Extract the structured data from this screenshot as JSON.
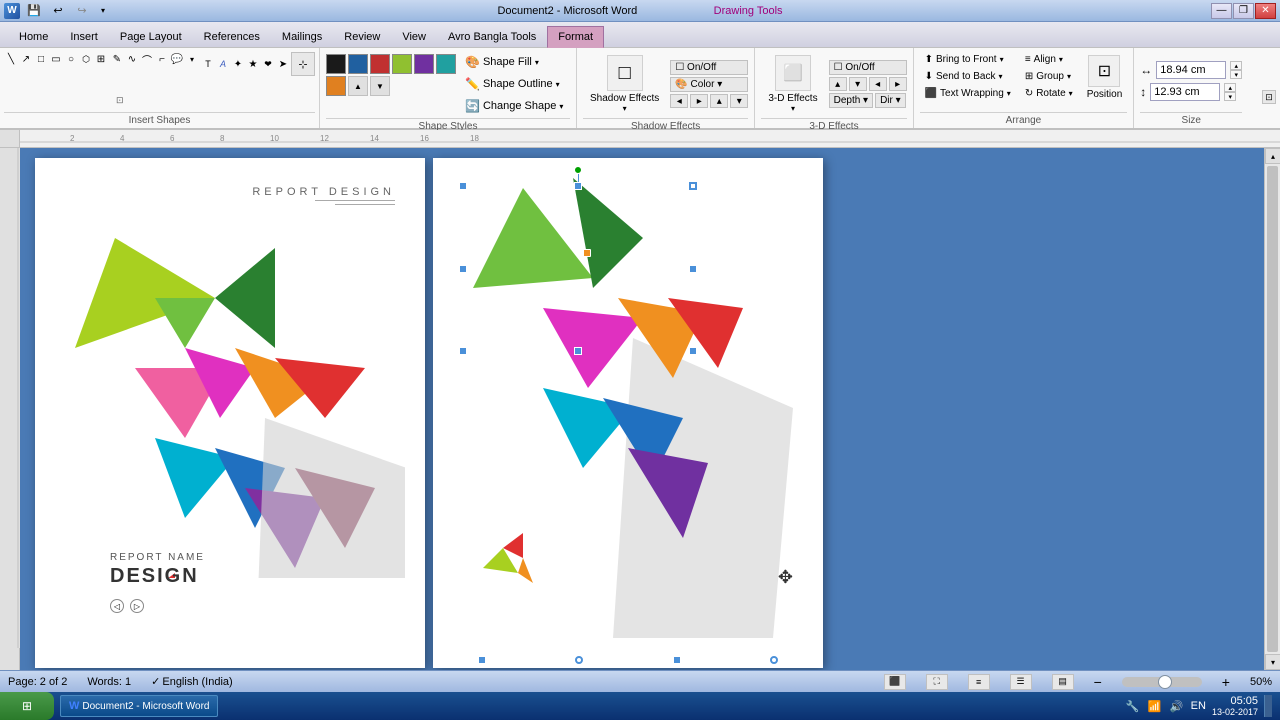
{
  "titlebar": {
    "title": "Document2 - Microsoft Word",
    "drawing_tools": "Drawing Tools",
    "minimize": "—",
    "restore": "❐",
    "close": "✕"
  },
  "qat": {
    "save": "💾",
    "undo": "↩",
    "redo": "↪",
    "customize": "▾"
  },
  "tabs": [
    {
      "label": "Home",
      "active": false
    },
    {
      "label": "Insert",
      "active": false
    },
    {
      "label": "Page Layout",
      "active": false
    },
    {
      "label": "References",
      "active": false
    },
    {
      "label": "Mailings",
      "active": false
    },
    {
      "label": "Review",
      "active": false
    },
    {
      "label": "View",
      "active": false
    },
    {
      "label": "Avro Bangla Tools",
      "active": false
    },
    {
      "label": "Format",
      "active": true
    }
  ],
  "ribbon": {
    "insert_shapes_label": "Insert Shapes",
    "shape_styles_label": "Shape Styles",
    "shadow_effects_label": "Shadow Effects",
    "three_d_effects_label": "3-D Effects",
    "arrange_label": "Arrange",
    "size_label": "Size",
    "shape_fill": "Shape Fill",
    "shape_outline": "Shape Outline",
    "change_shape": "Change Shape",
    "shadow_effects_btn": "Shadow Effects",
    "three_d_effects_btn": "3-D Effects",
    "bring_to_front": "Bring to Front",
    "send_to_back": "Send to Back",
    "text_wrapping": "Text Wrapping",
    "align": "Align",
    "group": "Group",
    "rotate": "Rotate",
    "position": "Position",
    "width_value": "18.94 cm",
    "height_value": "12.93 cm"
  },
  "colors": {
    "swatch1": "#1a1a1a",
    "swatch2": "#2060a0",
    "swatch3": "#c03030",
    "swatch4": "#90c030",
    "swatch5": "#7030a0",
    "swatch6": "#20a0a0",
    "swatch7": "#e08020"
  },
  "page1": {
    "title": "REPORT DESIGN",
    "report_name": "REPORT NAME",
    "design": "DESIGN"
  },
  "statusbar": {
    "page_info": "Page: 2 of 2",
    "words": "Words: 1",
    "language": "English (India)",
    "zoom": "50%",
    "date": "13-02-2017",
    "time": "05:05"
  },
  "taskbar": {
    "start_icon": "⊞",
    "word_item": "Document2 - Microsoft Word",
    "language_indicator": "EN"
  }
}
